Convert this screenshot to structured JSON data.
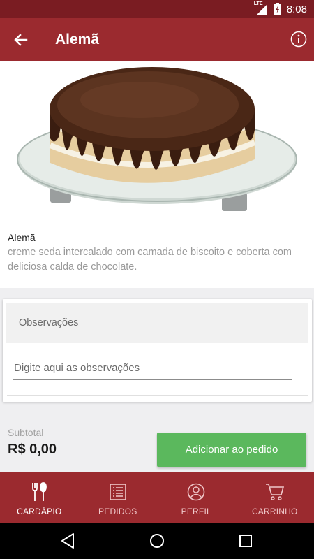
{
  "status_bar": {
    "time": "8:08",
    "network_label": "LTE",
    "icons": [
      "signal-icon",
      "battery-icon"
    ]
  },
  "app_bar": {
    "title": "Alemã",
    "back_icon": "arrow-back-icon",
    "info_icon": "info-icon"
  },
  "product": {
    "name": "Alemã",
    "description": "creme seda intercalado com camada de biscoito e coberta com deliciosa calda de chocolate.",
    "image": "chocolate-cake-image"
  },
  "observations": {
    "title": "Observações",
    "placeholder": "Digite aqui as observações",
    "value": ""
  },
  "order": {
    "subtotal_label": "Subtotal",
    "subtotal_value": "R$ 0,00",
    "add_button_label": "Adicionar ao pedido"
  },
  "bottom_nav": {
    "items": [
      {
        "label": "CARDÁPIO",
        "icon": "cutlery-icon",
        "active": true
      },
      {
        "label": "PEDIDOS",
        "icon": "list-icon",
        "active": false
      },
      {
        "label": "PERFIL",
        "icon": "profile-icon",
        "active": false
      },
      {
        "label": "CARRINHO",
        "icon": "cart-icon",
        "active": false
      }
    ]
  },
  "colors": {
    "primary": "#9b2a2f",
    "status_bar": "#7a1c22",
    "accent_button": "#5bb85d",
    "background": "#efeff1"
  },
  "system_nav": {
    "icons": [
      "back-triangle-icon",
      "home-circle-icon",
      "recents-square-icon"
    ]
  }
}
